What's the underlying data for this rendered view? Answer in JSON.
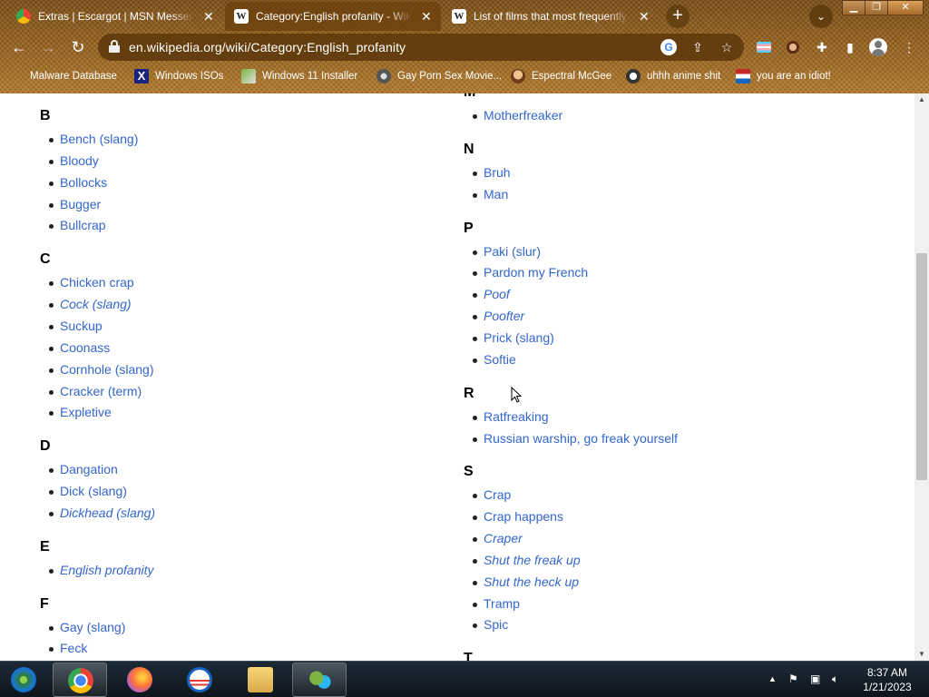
{
  "browser": {
    "tabs": [
      {
        "title": "Extras | Escargot | MSN Messenger",
        "favicon": "chrome-favicon-icon",
        "active": false
      },
      {
        "title": "Category:English profanity - Wikipedia",
        "favicon": "wikipedia-favicon-icon",
        "active": true
      },
      {
        "title": "List of films that most frequently use the word",
        "favicon": "wikipedia-favicon-icon",
        "active": false
      }
    ],
    "favicon_letter": "W",
    "close_glyph": "✕",
    "new_tab_glyph": "+",
    "url": "en.wikipedia.org/wiki/Category:English_profanity",
    "bookmarks": [
      {
        "label": "Malware Database"
      },
      {
        "label": "Windows ISOs"
      },
      {
        "label": "Windows 11 Installer"
      },
      {
        "label": "Gay Porn Sex Movie..."
      },
      {
        "label": "Espectral McGee"
      },
      {
        "label": "uhhh anime shit"
      },
      {
        "label": "you are an idiot!"
      }
    ]
  },
  "content": {
    "left_column": [
      {
        "letter": "B",
        "items": [
          {
            "text": "Bench (slang)",
            "italic": false
          },
          {
            "text": "Bloody",
            "italic": false
          },
          {
            "text": "Bollocks",
            "italic": false
          },
          {
            "text": "Bugger",
            "italic": false
          },
          {
            "text": "Bullcrap",
            "italic": false
          }
        ]
      },
      {
        "letter": "C",
        "items": [
          {
            "text": "Chicken crap",
            "italic": false
          },
          {
            "text": "Cock (slang)",
            "italic": true
          },
          {
            "text": "Suckup",
            "italic": false
          },
          {
            "text": "Coonass",
            "italic": false
          },
          {
            "text": "Cornhole (slang)",
            "italic": false
          },
          {
            "text": "Cracker (term)",
            "italic": false
          },
          {
            "text": "Expletive",
            "italic": false
          }
        ]
      },
      {
        "letter": "D",
        "items": [
          {
            "text": "Dangation",
            "italic": false
          },
          {
            "text": "Dick (slang)",
            "italic": false
          },
          {
            "text": "Dickhead (slang)",
            "italic": true
          }
        ]
      },
      {
        "letter": "E",
        "items": [
          {
            "text": "English profanity",
            "italic": true
          }
        ]
      },
      {
        "letter": "F",
        "items": [
          {
            "text": "Gay (slang)",
            "italic": false
          },
          {
            "text": "Feck",
            "italic": false
          }
        ]
      }
    ],
    "right_column": [
      {
        "letter": "M",
        "items": [
          {
            "text": "Motherfreaker",
            "italic": false
          }
        ]
      },
      {
        "letter": "N",
        "items": [
          {
            "text": "Bruh",
            "italic": false
          },
          {
            "text": "Man",
            "italic": false
          }
        ]
      },
      {
        "letter": "P",
        "items": [
          {
            "text": "Paki (slur)",
            "italic": false
          },
          {
            "text": "Pardon my French",
            "italic": false
          },
          {
            "text": "Poof",
            "italic": true
          },
          {
            "text": "Poofter",
            "italic": true
          },
          {
            "text": "Prick (slang)",
            "italic": false
          },
          {
            "text": "Softie",
            "italic": false
          }
        ]
      },
      {
        "letter": "R",
        "items": [
          {
            "text": "Ratfreaking",
            "italic": false
          },
          {
            "text": "Russian warship, go freak yourself",
            "italic": false
          }
        ]
      },
      {
        "letter": "S",
        "items": [
          {
            "text": "Crap",
            "italic": false
          },
          {
            "text": "Crap happens",
            "italic": false
          },
          {
            "text": "Craper",
            "italic": true
          },
          {
            "text": "Shut the freak up",
            "italic": true
          },
          {
            "text": "Shut the heck up",
            "italic": true
          },
          {
            "text": "Tramp",
            "italic": false
          },
          {
            "text": "Spic",
            "italic": false
          }
        ]
      },
      {
        "letter": "T",
        "items": []
      }
    ]
  },
  "taskbar": {
    "time": "8:37 AM",
    "date": "1/21/2023",
    "apps": [
      "windows-media-center-icon",
      "chrome-icon",
      "firefox-icon",
      "obama-logo-icon",
      "file-explorer-icon",
      "msn-messenger-icon"
    ]
  },
  "colors": {
    "link": "#3366cc",
    "chrome_theme": "#8a5a1c"
  }
}
